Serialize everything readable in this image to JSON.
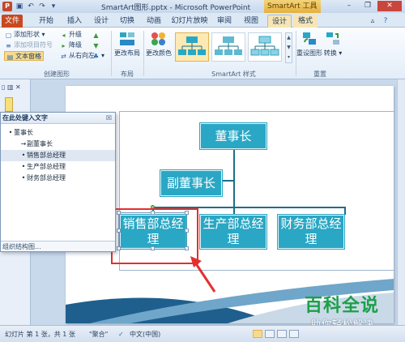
{
  "titlebar": {
    "title": "SmartArt图形.pptx - Microsoft PowerPoint",
    "context_title": "SmartArt 工具",
    "app_icon": "P",
    "quick_access": [
      "save-icon",
      "undo-icon",
      "redo-icon"
    ]
  },
  "tabs": [
    {
      "label": "文件"
    },
    {
      "label": "开始"
    },
    {
      "label": "插入"
    },
    {
      "label": "设计"
    },
    {
      "label": "切换"
    },
    {
      "label": "动画"
    },
    {
      "label": "幻灯片放映"
    },
    {
      "label": "审阅"
    },
    {
      "label": "视图"
    },
    {
      "label": "设计"
    },
    {
      "label": "格式"
    }
  ],
  "ribbon": {
    "create_group": {
      "add_shape": "添加形状",
      "add_bullet": "添加项目符号",
      "text_pane": "文本窗格",
      "promote": "升级",
      "demote": "降级",
      "right_to_left": "从右向左",
      "label": "创建图形"
    },
    "layout_group": {
      "change_layout": "更改布局",
      "label": "布局"
    },
    "styles_group": {
      "change_colors": "更改颜色",
      "label": "SmartArt 样式"
    },
    "reset_group": {
      "reset_graphic": "重设图形",
      "convert": "转换",
      "label": "重置"
    }
  },
  "text_pane": {
    "header": "在此处键入文字",
    "items": [
      {
        "text": "董事长",
        "bullet": "•"
      },
      {
        "text": "副董事长",
        "bullet": "→"
      },
      {
        "text": "销售部总经理",
        "bullet": "•"
      },
      {
        "text": "生产部总经理",
        "bullet": "•"
      },
      {
        "text": "财务部总经理",
        "bullet": "•"
      }
    ],
    "footer": "组织结构图..."
  },
  "diagram": {
    "chairman": "董事长",
    "vice_chairman": "副董事长",
    "sales_gm": "销售部总经理",
    "production_gm": "生产部总经理",
    "finance_gm": "财务部总经理",
    "node_color": "#2aa7c4",
    "connector_color": "#1d6f86"
  },
  "watermark": {
    "title": "百科全说",
    "subtitle": "助你轻松解决"
  },
  "statusbar": {
    "slide_info": "幻灯片 第 1 张，共 1 张",
    "theme": "\"聚合\"",
    "language": "中文(中国)"
  }
}
